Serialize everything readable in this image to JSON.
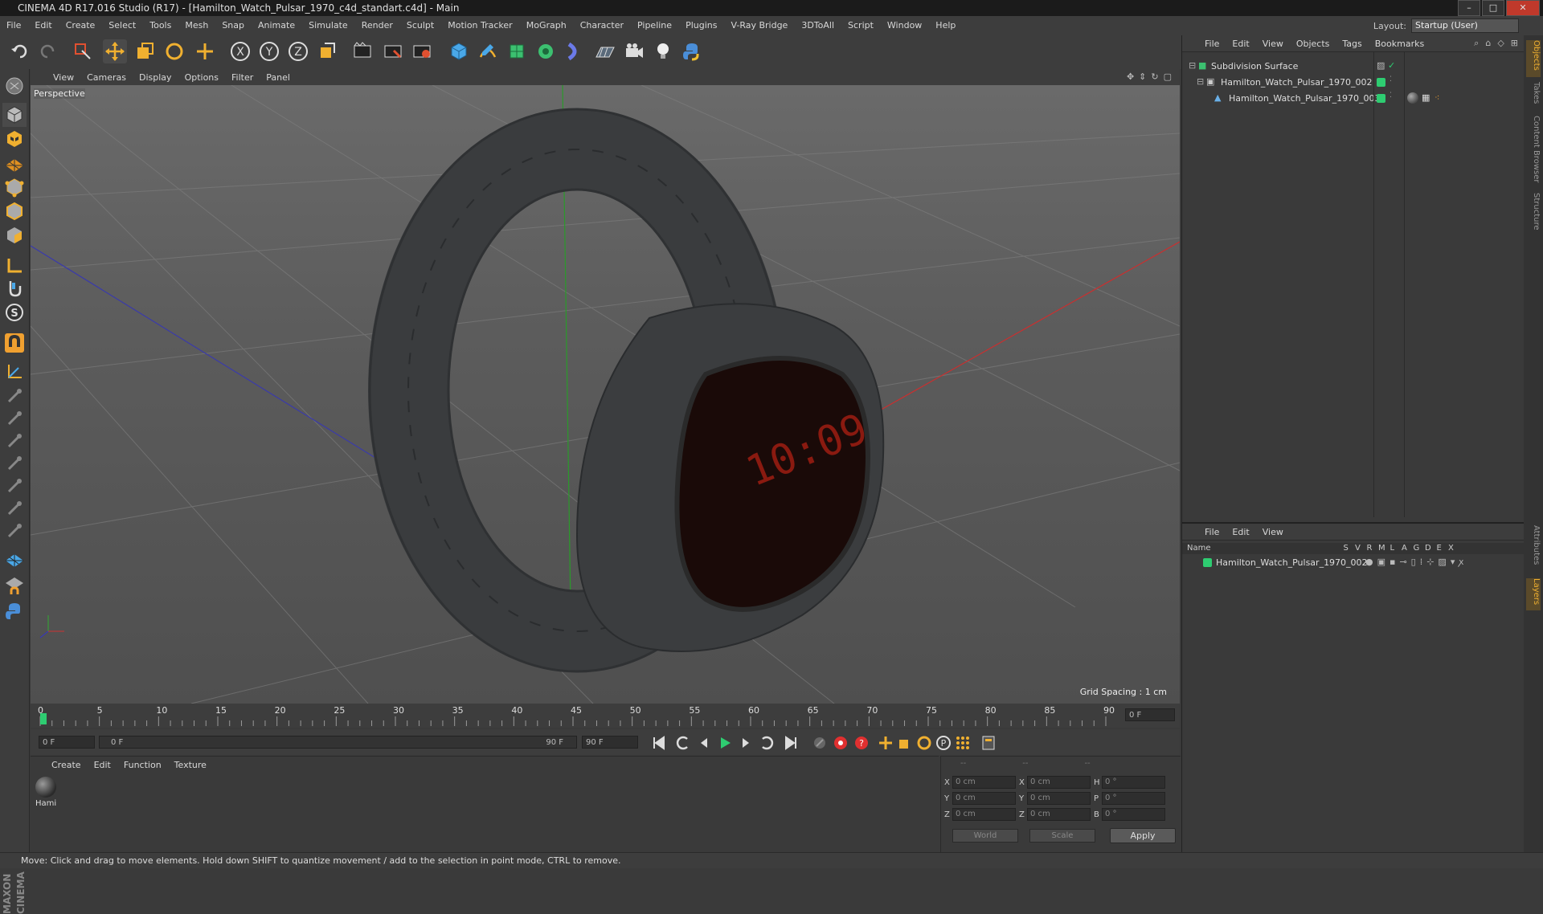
{
  "window": {
    "title": "CINEMA 4D R17.016 Studio (R17) - [Hamilton_Watch_Pulsar_1970_c4d_standart.c4d] - Main",
    "buttons": [
      "–",
      "□",
      "✕"
    ]
  },
  "menubar": {
    "items": [
      "File",
      "Edit",
      "Create",
      "Select",
      "Tools",
      "Mesh",
      "Snap",
      "Animate",
      "Simulate",
      "Render",
      "Sculpt",
      "Motion Tracker",
      "MoGraph",
      "Character",
      "Pipeline",
      "Plugins",
      "V-Ray Bridge",
      "3DToAll",
      "Script",
      "Window",
      "Help"
    ],
    "layout_label": "Layout:",
    "layout_value": "Startup (User)"
  },
  "viewport": {
    "menu": [
      "View",
      "Cameras",
      "Display",
      "Options",
      "Filter",
      "Panel"
    ],
    "label": "Perspective",
    "grid_spacing": "Grid Spacing : 1 cm",
    "display_time": "10:09"
  },
  "timeline": {
    "ticks": [
      "0",
      "5",
      "10",
      "15",
      "20",
      "25",
      "30",
      "35",
      "40",
      "45",
      "50",
      "55",
      "60",
      "65",
      "70",
      "75",
      "80",
      "85",
      "90"
    ],
    "current_frame": "0 F"
  },
  "playbar": {
    "start": "0 F",
    "range_start": "0 F",
    "range_end": "90 F",
    "end": "90 F"
  },
  "materials": {
    "menu": [
      "Create",
      "Edit",
      "Function",
      "Texture"
    ],
    "items": [
      {
        "name": "Hami"
      }
    ]
  },
  "coords": {
    "header": [
      "--",
      "--",
      "--"
    ],
    "rows": [
      {
        "a": "X",
        "av": "0 cm",
        "b": "X",
        "bv": "0 cm",
        "c": "H",
        "cv": "0 °"
      },
      {
        "a": "Y",
        "av": "0 cm",
        "b": "Y",
        "bv": "0 cm",
        "c": "P",
        "cv": "0 °"
      },
      {
        "a": "Z",
        "av": "0 cm",
        "b": "Z",
        "bv": "0 cm",
        "c": "B",
        "cv": "0 °"
      }
    ],
    "space": "World",
    "mode": "Scale",
    "apply": "Apply"
  },
  "object_manager": {
    "menu": [
      "File",
      "Edit",
      "View",
      "Objects",
      "Tags",
      "Bookmarks"
    ],
    "objects": [
      {
        "name": "Subdivision Surface"
      },
      {
        "name": "Hamilton_Watch_Pulsar_1970_002"
      },
      {
        "name": "Hamilton_Watch_Pulsar_1970_003"
      }
    ]
  },
  "layer_manager": {
    "menu": [
      "File",
      "Edit",
      "View"
    ],
    "columns": [
      "Name",
      "S",
      "V",
      "R",
      "M",
      "L",
      "A",
      "G",
      "D",
      "E",
      "X"
    ],
    "layers": [
      {
        "name": "Hamilton_Watch_Pulsar_1970_002"
      }
    ]
  },
  "side_tabs": [
    "Objects",
    "Takes",
    "Content Browser",
    "Structure",
    "Attributes",
    "Layers"
  ],
  "status": "Move: Click and drag to move elements. Hold down SHIFT to quantize movement / add to the selection in point mode, CTRL to remove.",
  "branding": "MAXON CINEMA 4D",
  "colors": {
    "accent": "#2ecc71",
    "highlight": "#f0b030",
    "record": "#e03030"
  }
}
